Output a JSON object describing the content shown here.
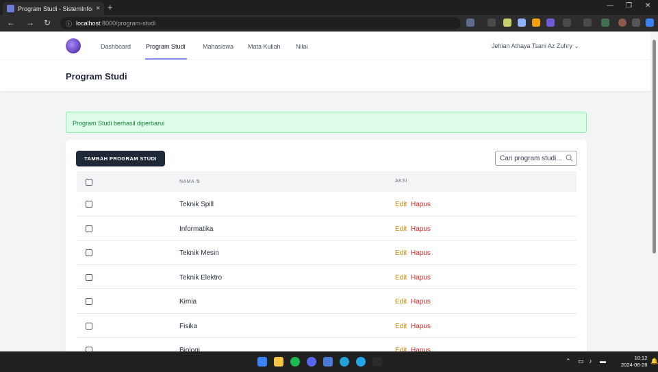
{
  "browser": {
    "tab_title": "Program Studi - SistemInformasi",
    "tab_close": "×",
    "new_tab": "+",
    "url_host": "localhost",
    "url_path": ":8000/program-studi"
  },
  "nav": {
    "links": [
      "Dashboard",
      "Program Studi",
      "Mahasiswa",
      "Mata Kuliah",
      "Nilai"
    ],
    "active": "Program Studi",
    "user": "Jehian Athaya Tsani Az Zuhry"
  },
  "page": {
    "title": "Program Studi",
    "alert": "Program Studi berhasil diperbarui"
  },
  "toolbar": {
    "add_label": "TAMBAH PROGRAM STUDI",
    "search_placeholder": "Cari program studi..."
  },
  "table": {
    "headers": {
      "name": "NAMA ⇅",
      "action": "AKSI"
    },
    "edit_label": "Edit",
    "delete_label": "Hapus",
    "rows": [
      {
        "name": "Teknik Spill"
      },
      {
        "name": "Informatika"
      },
      {
        "name": "Teknik Mesin"
      },
      {
        "name": "Teknik Elektro"
      },
      {
        "name": "Kimia"
      },
      {
        "name": "Fisika"
      },
      {
        "name": "Biologi"
      }
    ]
  },
  "taskbar": {
    "time": "10:12",
    "date": "2024-06-28"
  },
  "colors": {
    "primary_dark": "#1f2937",
    "edit": "#ca8a04",
    "delete": "#dc2626",
    "alert_bg": "#dcfce7",
    "alert_text": "#15803d",
    "accent": "#818cf8"
  }
}
